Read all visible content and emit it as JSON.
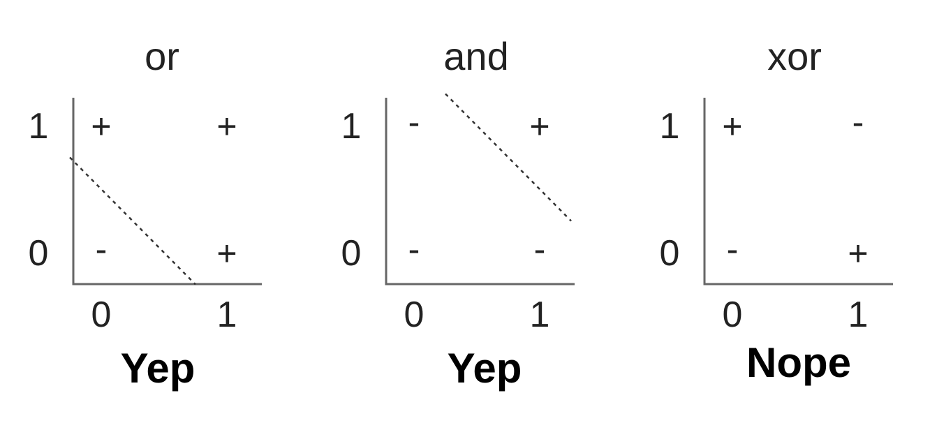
{
  "panels": [
    {
      "id": "or",
      "title": "or",
      "x_ticks": [
        "0",
        "1"
      ],
      "y_ticks": [
        "0",
        "1"
      ],
      "points": [
        {
          "x": 0,
          "y": 1,
          "label": "+"
        },
        {
          "x": 1,
          "y": 1,
          "label": "+"
        },
        {
          "x": 0,
          "y": 0,
          "label": "-"
        },
        {
          "x": 1,
          "y": 0,
          "label": "+"
        }
      ],
      "separator": [
        [
          -0.25,
          0.75
        ],
        [
          0.75,
          -0.25
        ]
      ],
      "verdict": "Yep"
    },
    {
      "id": "and",
      "title": "and",
      "x_ticks": [
        "0",
        "1"
      ],
      "y_ticks": [
        "0",
        "1"
      ],
      "points": [
        {
          "x": 0,
          "y": 1,
          "label": "-"
        },
        {
          "x": 1,
          "y": 1,
          "label": "+"
        },
        {
          "x": 0,
          "y": 0,
          "label": "-"
        },
        {
          "x": 1,
          "y": 0,
          "label": "-"
        }
      ],
      "separator": [
        [
          0.25,
          1.25
        ],
        [
          1.25,
          0.25
        ]
      ],
      "verdict": "Yep"
    },
    {
      "id": "xor",
      "title": "xor",
      "x_ticks": [
        "0",
        "1"
      ],
      "y_ticks": [
        "0",
        "1"
      ],
      "points": [
        {
          "x": 0,
          "y": 1,
          "label": "+"
        },
        {
          "x": 1,
          "y": 1,
          "label": "-"
        },
        {
          "x": 0,
          "y": 0,
          "label": "-"
        },
        {
          "x": 1,
          "y": 0,
          "label": "+"
        }
      ],
      "separator": null,
      "verdict": "Nope"
    }
  ]
}
